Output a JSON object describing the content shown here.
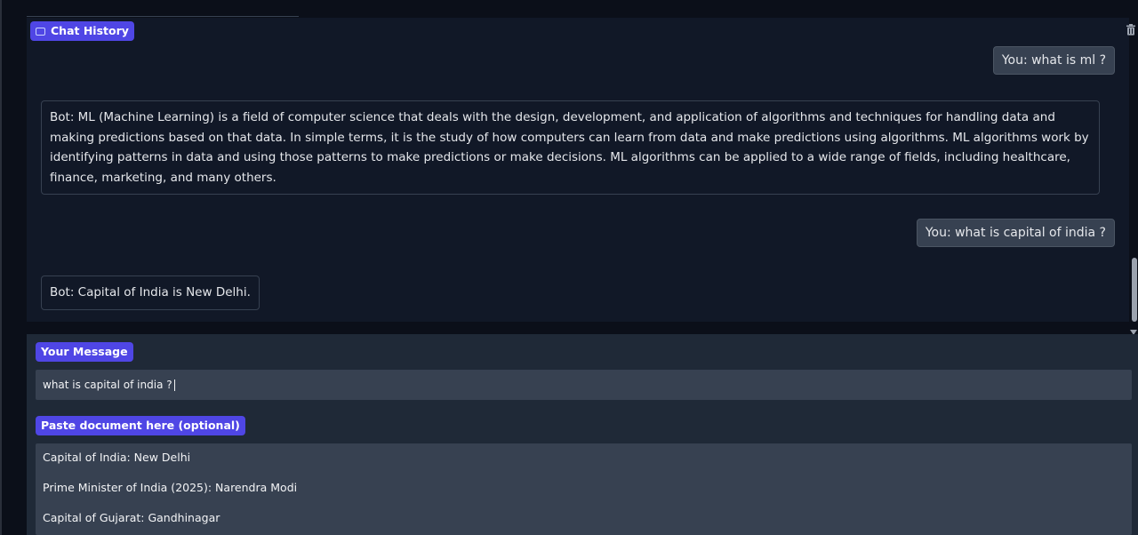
{
  "chat_history": {
    "label": "Chat History",
    "messages": [
      {
        "role": "user",
        "text": "You: what is ml ?"
      },
      {
        "role": "bot",
        "text": "Bot: ML (Machine Learning) is a field of computer science that deals with the design, development, and application of algorithms and techniques for handling data and making predictions based on that data. In simple terms, it is the study of how computers can learn from data and make predictions using algorithms. ML algorithms work by identifying patterns in data and using those patterns to make predictions or make decisions. ML algorithms can be applied to a wide range of fields, including healthcare, finance, marketing, and many others."
      },
      {
        "role": "user",
        "text": "You: what is capital of india ?"
      },
      {
        "role": "bot",
        "text": "Bot: Capital of India is New Delhi."
      }
    ]
  },
  "message_input": {
    "label": "Your Message",
    "value": "what is capital of india ?"
  },
  "document_input": {
    "label": "Paste document here (optional)",
    "lines": [
      "Capital of India: New Delhi",
      "Prime Minister of India (2025): Narendra Modi",
      "Capital of Gujarat: Gandhinagar"
    ]
  },
  "icons": {
    "chat_history": "chat-bubble-icon",
    "clear": "trash-icon"
  },
  "colors": {
    "accent": "#4f46e5",
    "background": "#0b0f19",
    "panel": "#111827",
    "input_panel": "#1f2937",
    "field": "#374151"
  }
}
